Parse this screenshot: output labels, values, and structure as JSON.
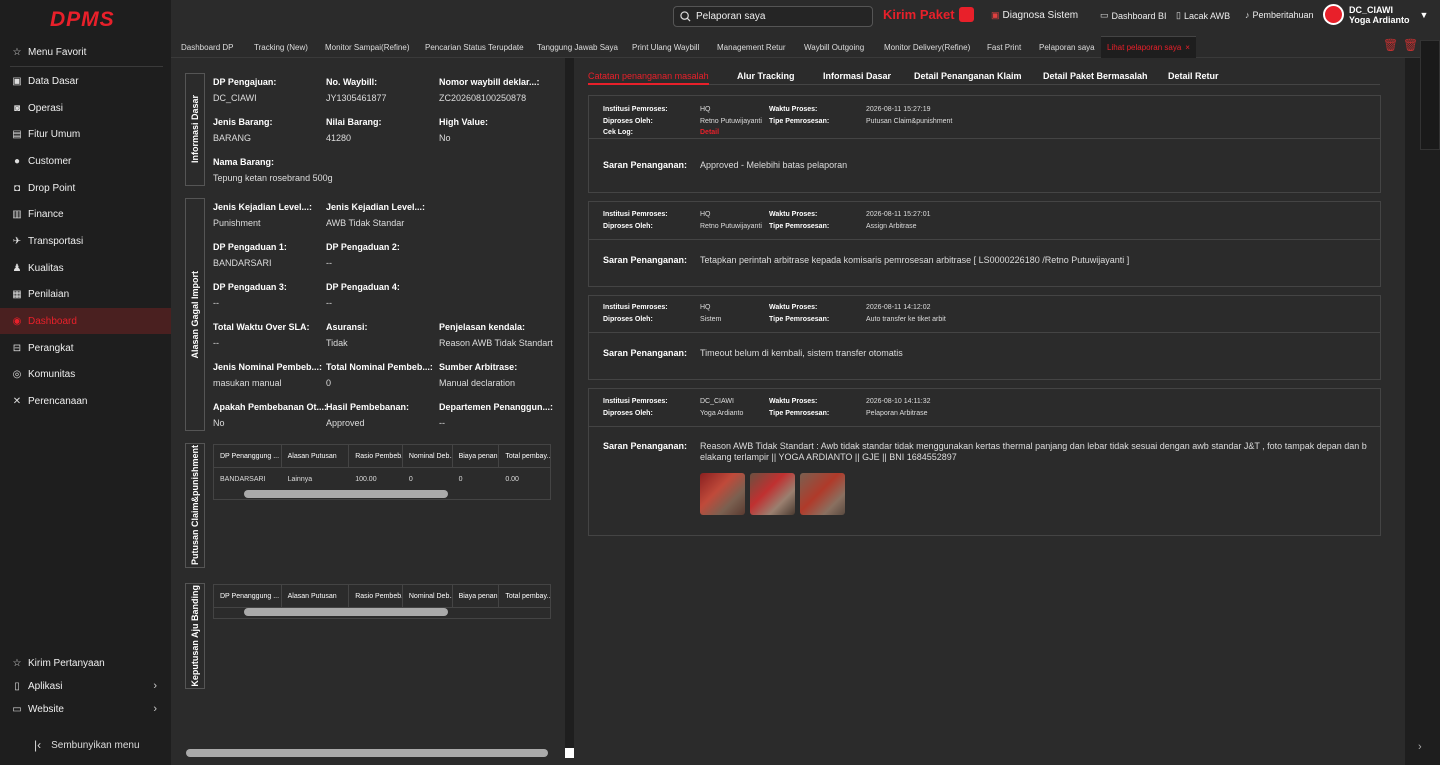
{
  "app": {
    "logo": "DPMS"
  },
  "sidebar": {
    "items": [
      {
        "label": "Menu Favorit",
        "icon": "star-icon"
      },
      {
        "label": "Data Dasar",
        "icon": "database-icon"
      },
      {
        "label": "Operasi",
        "icon": "operation-icon"
      },
      {
        "label": "Fitur Umum",
        "icon": "briefcase-icon"
      },
      {
        "label": "Customer",
        "icon": "user-icon"
      },
      {
        "label": "Drop Point",
        "icon": "drop-point-icon"
      },
      {
        "label": "Finance",
        "icon": "finance-icon"
      },
      {
        "label": "Transportasi",
        "icon": "plane-icon"
      },
      {
        "label": "Kualitas",
        "icon": "quality-icon"
      },
      {
        "label": "Penilaian",
        "icon": "print-icon"
      },
      {
        "label": "Dashboard",
        "icon": "dashboard-icon"
      },
      {
        "label": "Perangkat",
        "icon": "device-icon"
      },
      {
        "label": "Komunitas",
        "icon": "community-icon"
      },
      {
        "label": "Perencanaan",
        "icon": "tools-icon"
      }
    ],
    "bottom": [
      {
        "label": "Kirim Pertanyaan"
      },
      {
        "label": "Aplikasi"
      },
      {
        "label": "Website"
      }
    ],
    "hide_label": "Sembunyikan menu"
  },
  "header": {
    "search_value": "Pelaporan saya",
    "kirim_paket": "Kirim Paket",
    "diagnosa": "Diagnosa Sistem",
    "dashboard_bi": "Dashboard BI",
    "lacak_awb": "Lacak AWB",
    "pemberitahuan": "Pemberitahuan",
    "user_code": "DC_CIAWI",
    "user_name": "Yoga Ardianto"
  },
  "tabs": [
    "Dashboard DP",
    "Tracking (New)",
    "Monitor Sampai(Refine)",
    "Pencarian Status Terupdate",
    "Tanggung Jawab Saya",
    "Print Ulang Waybill",
    "Management Retur",
    "Waybill Outgoing",
    "Monitor Delivery(Refine)",
    "Fast Print",
    "Pelaporan saya",
    "Lihat pelaporan saya"
  ],
  "left": {
    "sections": {
      "informasi_dasar": "Informasi Dasar",
      "alasan": "Alasan Gagal Import",
      "putusan": "Putusan Claim&punishment",
      "keputusan": "Keputusan Aju Banding"
    },
    "fields": {
      "dp_pengajuan": {
        "label": "DP Pengajuan:",
        "value": "DC_CIAWI"
      },
      "no_waybill": {
        "label": "No. Waybill:",
        "value": "JY1305461877"
      },
      "nomor_deklar": {
        "label": "Nomor waybill deklar...:",
        "value": "ZC202608100250878"
      },
      "jenis_barang": {
        "label": "Jenis Barang:",
        "value": "BARANG"
      },
      "nilai_barang": {
        "label": "Nilai Barang:",
        "value": "41280"
      },
      "high_value": {
        "label": "High Value:",
        "value": "No"
      },
      "nama_barang": {
        "label": "Nama Barang:",
        "value": "Tepung ketan rosebrand 500g"
      },
      "jenis_kejadian1": {
        "label": "Jenis Kejadian Level...:",
        "value": "Punishment"
      },
      "jenis_kejadian2": {
        "label": "Jenis Kejadian Level...:",
        "value": "AWB Tidak Standar"
      },
      "dp_pengaduan1": {
        "label": "DP Pengaduan 1:",
        "value": "BANDARSARI"
      },
      "dp_pengaduan2": {
        "label": "DP Pengaduan 2:",
        "value": "--"
      },
      "dp_pengaduan3": {
        "label": "DP Pengaduan 3:",
        "value": "--"
      },
      "dp_pengaduan4": {
        "label": "DP Pengaduan 4:",
        "value": "--"
      },
      "total_waktu": {
        "label": "Total Waktu Over SLA:",
        "value": "--"
      },
      "asuransi": {
        "label": "Asuransi:",
        "value": "Tidak"
      },
      "penjelasan": {
        "label": "Penjelasan kendala:",
        "value": "Reason AWB Tidak Standart"
      },
      "jenis_nominal": {
        "label": "Jenis Nominal Pembeb...:",
        "value": "masukan manual"
      },
      "total_nominal": {
        "label": "Total Nominal Pembeb...:",
        "value": "0"
      },
      "sumber": {
        "label": "Sumber Arbitrase:",
        "value": "Manual declaration"
      },
      "apakah": {
        "label": "Apakah Pembebanan Ot...:",
        "value": "No"
      },
      "hasil": {
        "label": "Hasil Pembebanan:",
        "value": "Approved"
      },
      "departemen": {
        "label": "Departemen Penanggun...:",
        "value": "--"
      }
    },
    "table_headers": [
      "DP Penanggung ...",
      "Alasan Putusan",
      "Rasio Pembeb...",
      "Nominal Deb...",
      "Biaya penan...",
      "Total pembay..."
    ],
    "table_row": [
      "BANDARSARI",
      "Lainnya",
      "100.00",
      "0",
      "0",
      "0.00"
    ]
  },
  "right": {
    "tabs": [
      "Catatan penanganan masalah",
      "Alur Tracking",
      "Informasi Dasar",
      "Detail Penanganan Klaim",
      "Detail Paket Bermasalah",
      "Detail Retur"
    ],
    "labels": {
      "institusi": "Institusi Pemroses:",
      "diproses": "Diproses Oleh:",
      "cek_log": "Cek Log:",
      "waktu": "Waktu Proses:",
      "tipe": "Tipe Pemrosesan:",
      "saran": "Saran Penanganan:",
      "detail": "Detail"
    },
    "records": [
      {
        "institusi": "HQ",
        "diproses": "Retno Putuwijayanti",
        "waktu": "2026-08-11 15:27:19",
        "tipe": "Putusan Claim&punishment",
        "saran": "Approved - Melebihi batas pelaporan"
      },
      {
        "institusi": "HQ",
        "diproses": "Retno Putuwijayanti",
        "waktu": "2026-08-11 15:27:01",
        "tipe": "Assign Arbitrase",
        "saran": "Tetapkan perintah arbitrase kepada komisaris pemrosesan arbitrase [ LS0000226180 /Retno Putuwijayanti ]"
      },
      {
        "institusi": "HQ",
        "diproses": "Sistem",
        "waktu": "2026-08-11 14:12:02",
        "tipe": "Auto transfer ke tiket arbit",
        "saran": "Timeout belum di kembali, sistem transfer otomatis"
      },
      {
        "institusi": "DC_CIAWI",
        "diproses": "Yoga Ardianto",
        "waktu": "2026-08-10 14:11:32",
        "tipe": "Pelaporan Arbitrase",
        "saran": "Reason AWB Tidak Standart : Awb tidak standar tidak menggunakan kertas thermal panjang dan lebar tidak sesuai dengan awb standar J&T , foto tampak depan dan belakang terlampir || YOGA ARDIANTO || GJE || BNI 1684552897"
      }
    ]
  },
  "colors": {
    "accent": "#e8202a",
    "bg": "#2b2b2b",
    "sidebar": "#1e1e1e"
  }
}
